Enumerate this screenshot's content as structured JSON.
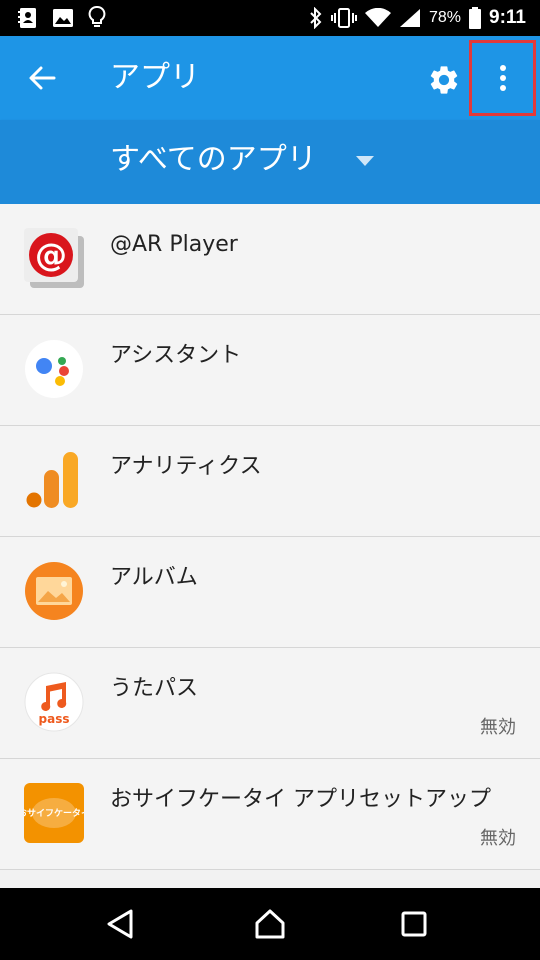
{
  "status_bar": {
    "battery_percent": "78%",
    "time": "9:11"
  },
  "app_bar": {
    "title": "アプリ"
  },
  "filter": {
    "selected": "すべてのアプリ"
  },
  "apps": [
    {
      "name": "@AR Player",
      "status": "",
      "icon": "ar-player-icon"
    },
    {
      "name": "アシスタント",
      "status": "",
      "icon": "assistant-icon"
    },
    {
      "name": "アナリティクス",
      "status": "",
      "icon": "analytics-icon"
    },
    {
      "name": "アルバム",
      "status": "",
      "icon": "album-icon"
    },
    {
      "name": "うたパス",
      "status": "無効",
      "icon": "utapass-icon",
      "icon_text": "pass"
    },
    {
      "name": "おサイフケータイ アプリセットアップ",
      "status": "無効",
      "icon": "osaifu-keitai-icon",
      "icon_text": "おサイフケータイ"
    }
  ],
  "colors": {
    "app_bar": "#1e95e6",
    "filter_bar": "#1e8ad9",
    "highlight_box": "#e23a3a"
  }
}
